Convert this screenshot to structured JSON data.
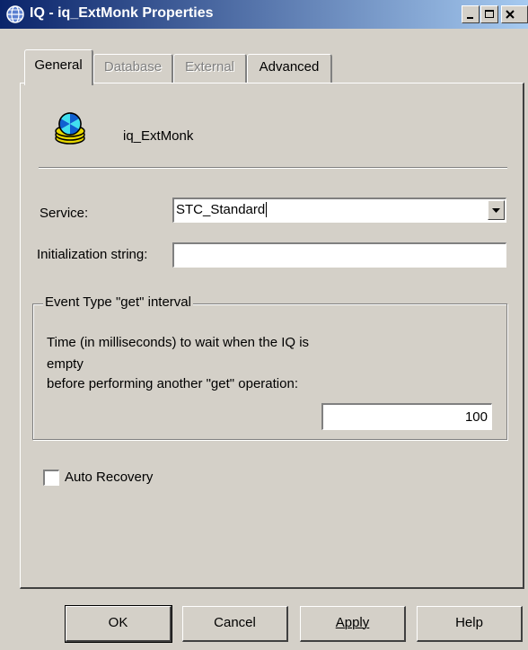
{
  "window": {
    "title": "IQ - iq_ExtMonk Properties",
    "controls": {
      "minimize": "minimize-icon",
      "maximize": "maximize-icon",
      "close": "close-icon"
    }
  },
  "tabs": [
    {
      "label": "General",
      "state": "active"
    },
    {
      "label": "Database",
      "state": "disabled"
    },
    {
      "label": "External",
      "state": "disabled"
    },
    {
      "label": "Advanced",
      "state": "enabled"
    }
  ],
  "general": {
    "object_name": "iq_ExtMonk",
    "service_label": "Service:",
    "service_value": "STC_Standard",
    "init_label": "Initialization string:",
    "init_value": "",
    "group_title": "Event Type \"get\" interval",
    "description_lines": [
      "Time (in milliseconds) to wait when the IQ is",
      "empty",
      "before performing another \"get\" operation:"
    ],
    "interval_value": "100",
    "auto_recovery_label": "Auto Recovery",
    "auto_recovery_checked": false
  },
  "buttons": {
    "ok": "OK",
    "cancel": "Cancel",
    "apply": "Apply",
    "help": "Help"
  },
  "colors": {
    "titlebar_start": "#0a246a",
    "titlebar_end": "#a6caf0",
    "face": "#d4d0c8"
  }
}
